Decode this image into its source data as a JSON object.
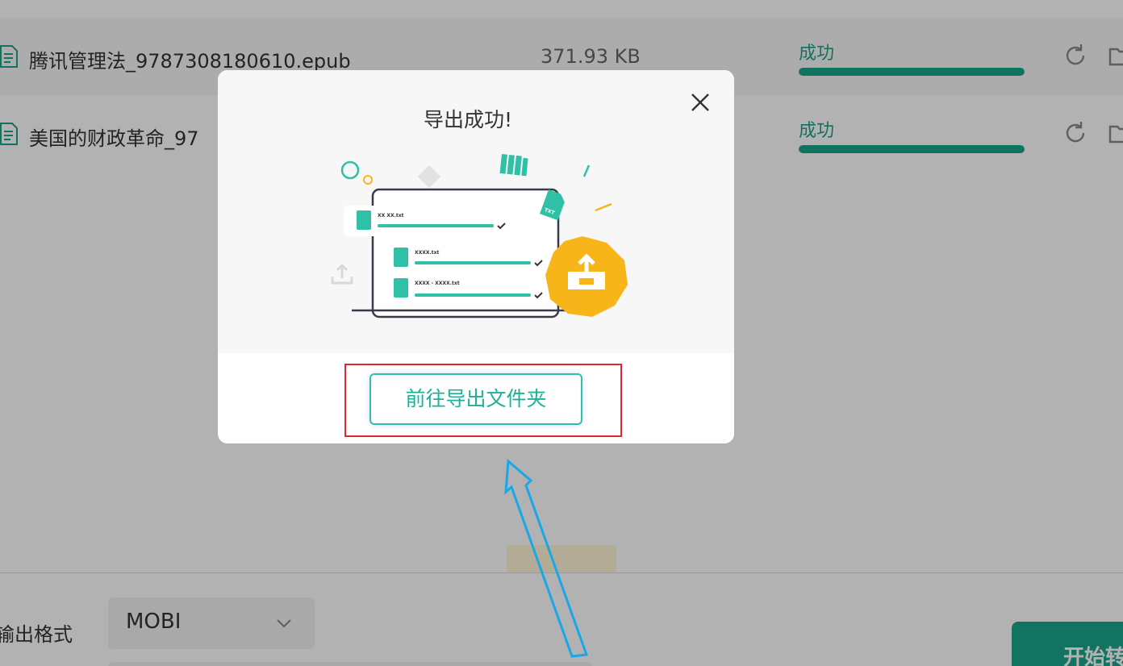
{
  "files": [
    {
      "name": "腾讯管理法_9787308180610.epub",
      "size": "371.93 KB",
      "status": "成功",
      "progress_percent": 100
    },
    {
      "name": "美国的财政革命_97",
      "size": "",
      "status": "成功",
      "progress_percent": 100
    }
  ],
  "bottom_bar": {
    "format_label": "输出格式",
    "format_value": "MOBI",
    "start_button_label": "开始转"
  },
  "dialog": {
    "title": "导出成功!",
    "open_folder_button": "前往导出文件夹",
    "illustration_text": {
      "row1": "XX XX.txt",
      "row2": "XXXX.txt",
      "row3": "XXXX - XXXX.txt",
      "badge": "TXT"
    }
  },
  "colors": {
    "accent": "#17a58a",
    "button_border": "#2fc0a6",
    "highlight_border": "#e5262e",
    "annotation_arrow": "#1aa7e8",
    "upload_badge": "#f7b51a"
  },
  "icons": {
    "file": "file-text-icon",
    "refresh": "refresh-icon",
    "folder": "folder-icon",
    "close": "close-icon",
    "chevron": "chevron-down-icon"
  }
}
